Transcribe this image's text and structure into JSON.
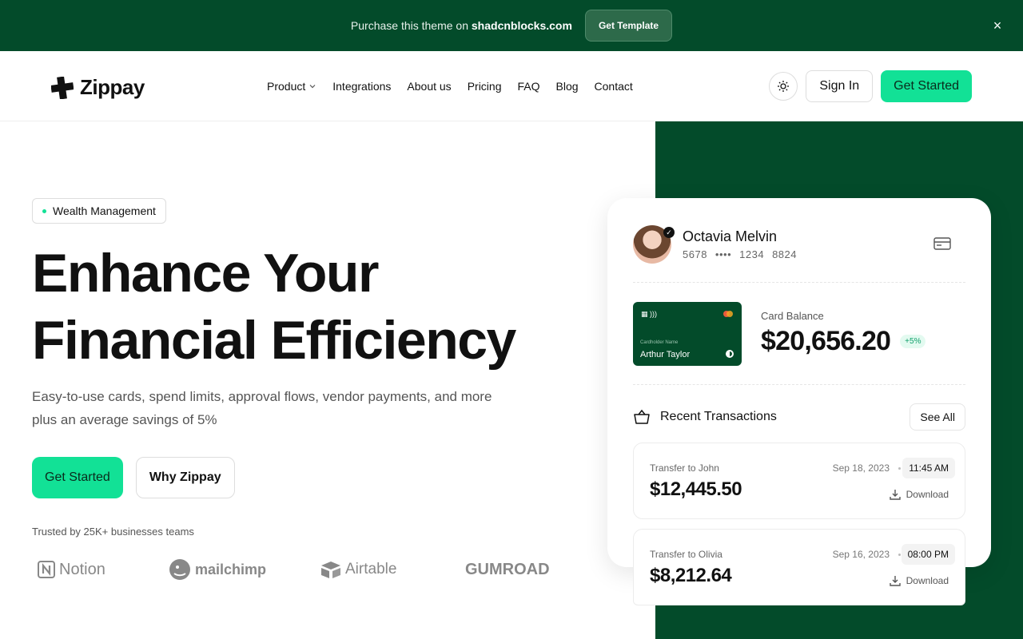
{
  "banner": {
    "text_prefix": "Purchase this theme on ",
    "text_site": "shadcnblocks.com",
    "button": "Get Template",
    "close": "×"
  },
  "nav": {
    "logo": "Zippay",
    "links": [
      "Product",
      "Integrations",
      "About us",
      "Pricing",
      "FAQ",
      "Blog",
      "Contact"
    ],
    "sign_in": "Sign In",
    "get_started": "Get Started"
  },
  "hero": {
    "pill": "Wealth Management",
    "title_line1": "Enhance Your",
    "title_line2": "Financial Efficiency",
    "description": "Easy-to-use cards, spend limits, approval flows, vendor payments, and more plus an average savings of 5%",
    "primary_button": "Get Started",
    "secondary_button": "Why Zippay",
    "trusted": "Trusted by 25K+ businesses teams",
    "logos": [
      "Notion",
      "mailchimp",
      "Airtable",
      "GUMROAD"
    ]
  },
  "dashboard": {
    "user_name": "Octavia Melvin",
    "card_number": [
      "5678",
      "••••",
      "1234",
      "8824"
    ],
    "mini_card": {
      "holder_label": "Cardholder Name",
      "holder": "Arthur Taylor"
    },
    "balance_label": "Card Balance",
    "balance": "$20,656.20",
    "balance_change": "+5%",
    "transactions_title": "Recent Transactions",
    "see_all": "See All",
    "transactions": [
      {
        "to": "Transfer to John",
        "amount": "$12,445.50",
        "date": "Sep 18, 2023",
        "time": "11:45 AM",
        "action": "Download"
      },
      {
        "to": "Transfer to Olivia",
        "amount": "$8,212.64",
        "date": "Sep 16, 2023",
        "time": "08:00 PM",
        "action": "Download"
      }
    ]
  },
  "colors": {
    "brand_dark": "#034b2a",
    "accent": "#12e196"
  }
}
